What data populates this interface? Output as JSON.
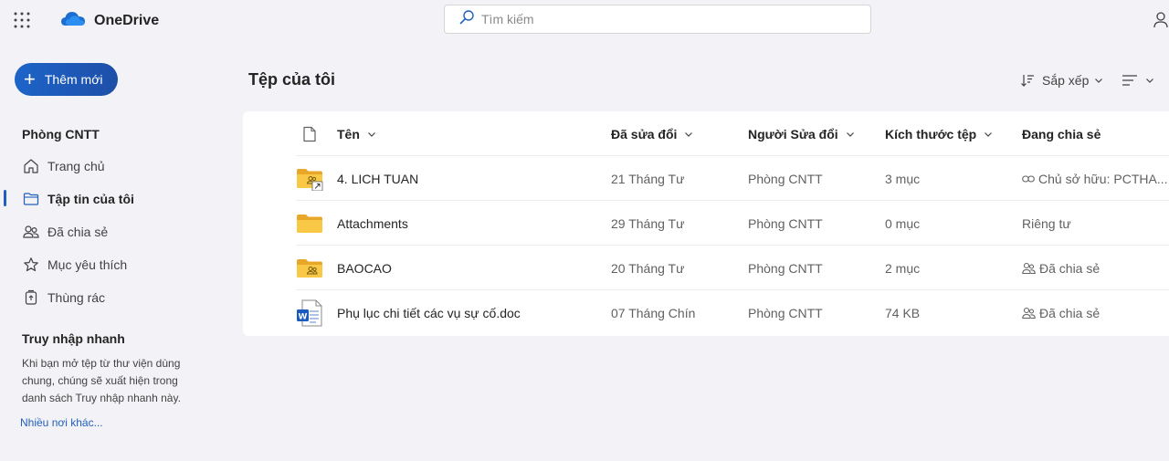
{
  "app": {
    "name": "OneDrive"
  },
  "search": {
    "placeholder": "Tìm kiếm"
  },
  "new_button": {
    "label": "Thêm mới"
  },
  "sidebar": {
    "section_title": "Phòng CNTT",
    "items": [
      {
        "label": "Trang chủ",
        "icon": "home-icon"
      },
      {
        "label": "Tập tin của tôi",
        "icon": "folder-icon",
        "active": true
      },
      {
        "label": "Đã chia sẻ",
        "icon": "people-icon"
      },
      {
        "label": "Mục yêu thích",
        "icon": "star-icon"
      },
      {
        "label": "Thùng rác",
        "icon": "trash-icon"
      }
    ],
    "quick_access": {
      "title": "Truy nhập nhanh",
      "description": "Khi bạn mở tệp từ thư viện dùng chung, chúng sẽ xuất hiện trong danh sách Truy nhập nhanh này.",
      "more_link": "Nhiều nơi khác..."
    }
  },
  "main": {
    "title": "Tệp của tôi",
    "sort_label": "Sắp xếp",
    "columns": {
      "name": "Tên",
      "modified": "Đã sửa đổi",
      "modified_by": "Người Sửa đổi",
      "size": "Kích thước tệp",
      "sharing": "Đang chia sẻ"
    },
    "files": [
      {
        "icon": "shared-folder-shortcut-icon",
        "name": "4. LICH TUAN",
        "modified": "21 Tháng Tư",
        "modified_by": "Phòng CNTT",
        "size": "3 mục",
        "sharing": "Chủ sở hữu: PCTHA...",
        "sharing_icon": "link-icon"
      },
      {
        "icon": "folder-icon",
        "name": "Attachments",
        "modified": "29 Tháng Tư",
        "modified_by": "Phòng CNTT",
        "size": "0 mục",
        "sharing": "Riêng tư",
        "sharing_icon": ""
      },
      {
        "icon": "shared-folder-icon",
        "name": "BAOCAO",
        "modified": "20 Tháng Tư",
        "modified_by": "Phòng CNTT",
        "size": "2 mục",
        "sharing": "Đã chia sẻ",
        "sharing_icon": "people-icon"
      },
      {
        "icon": "word-document-icon",
        "name": "Phụ lục chi tiết các vụ sự cố.doc",
        "modified": "07 Tháng Chín",
        "modified_by": "Phòng CNTT",
        "size": "74 KB",
        "sharing": "Đã chia sẻ",
        "sharing_icon": "people-icon"
      }
    ]
  },
  "colors": {
    "accent": "#1f5fbf",
    "folder": "#f6c543",
    "word": "#185abd"
  }
}
